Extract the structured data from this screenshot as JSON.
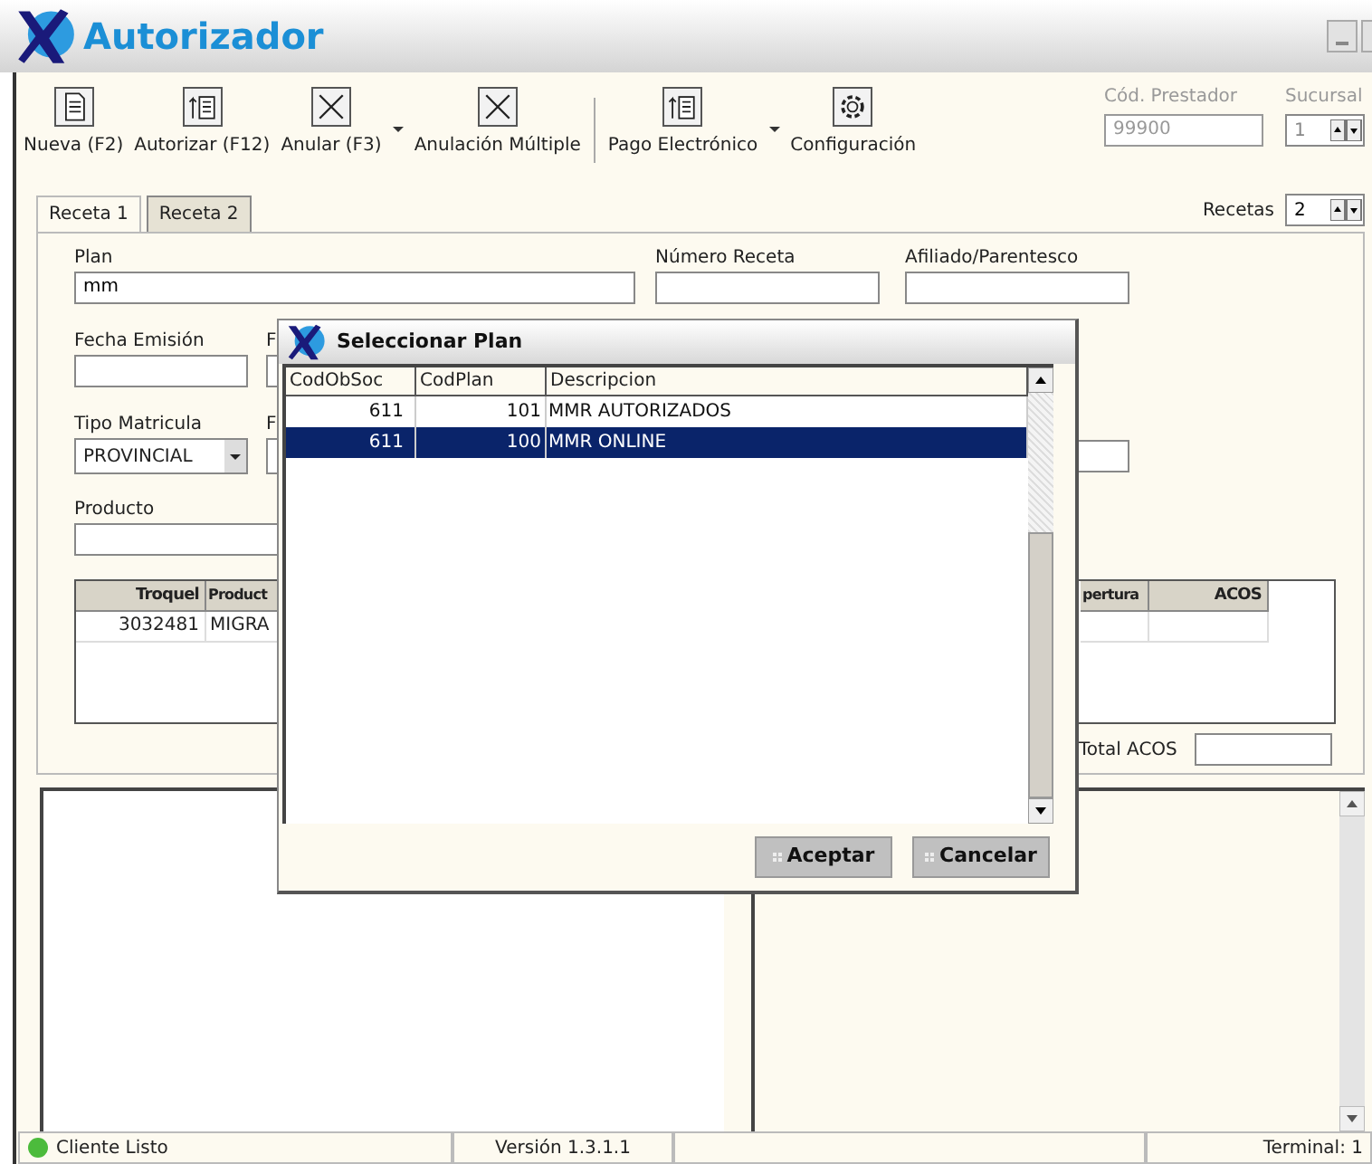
{
  "window": {
    "title": "Autorizador"
  },
  "toolbar": [
    {
      "kind": "button",
      "label": "Nueva (F2)",
      "dropdown": false
    },
    {
      "kind": "button",
      "label": "Autorizar (F12)",
      "dropdown": false
    },
    {
      "kind": "button",
      "label": "Anular (F3)",
      "dropdown": true
    },
    {
      "kind": "button",
      "label": "Anulación Múltiple",
      "dropdown": false
    },
    {
      "kind": "separator"
    },
    {
      "kind": "button",
      "label": "Pago Electrónico",
      "dropdown": true
    },
    {
      "kind": "button",
      "label": "Configuración",
      "dropdown": false
    }
  ],
  "prestador": {
    "label": "Cód. Prestador",
    "value": "99900",
    "disabled": true
  },
  "sucursal": {
    "label": "Sucursal",
    "value": "1",
    "disabled": true
  },
  "tabs": [
    {
      "label": "Receta 1",
      "selected": false
    },
    {
      "label": "Receta 2",
      "selected": true
    }
  ],
  "recetas": {
    "label": "Recetas",
    "value": "2"
  },
  "form": {
    "plan": {
      "label": "Plan",
      "value": "mm"
    },
    "numero_receta": {
      "label": "Número Receta"
    },
    "afiliado": {
      "label": "Afiliado/Parentesco"
    },
    "fecha_emision": {
      "label": "Fecha Emisión"
    },
    "field_5": {
      "label": "F"
    },
    "tipo_matricula": {
      "label": "Tipo Matricula",
      "value": "PROVINCIAL"
    },
    "field_7": {
      "label": "F"
    },
    "producto": {
      "label": "Producto"
    }
  },
  "items_table": {
    "columns": [
      "Troquel",
      "Product",
      "pertura",
      "ACOS"
    ],
    "rows": [
      {
        "troquel": "3032481",
        "product": "MIGRA"
      }
    ]
  },
  "total": {
    "label": "Total ACOS"
  },
  "dialog": {
    "title": "Seleccionar Plan",
    "columns": [
      "CodObSoc",
      "CodPlan",
      "Descripcion"
    ],
    "rows": [
      {
        "cells": [
          "611",
          "101",
          "MMR AUTORIZADOS"
        ],
        "selected": false
      },
      {
        "cells": [
          "611",
          "100",
          "MMR ONLINE"
        ],
        "selected": true
      }
    ],
    "buttons": [
      "Aceptar",
      "Cancelar"
    ]
  },
  "status_bar": [
    {
      "kind": "text",
      "text": "Cliente Listo",
      "connected": true
    },
    {
      "kind": "text",
      "text": "Versión 1.3.1.1"
    },
    {
      "kind": "empty"
    },
    {
      "kind": "text",
      "text": "Terminal: 1"
    }
  ]
}
